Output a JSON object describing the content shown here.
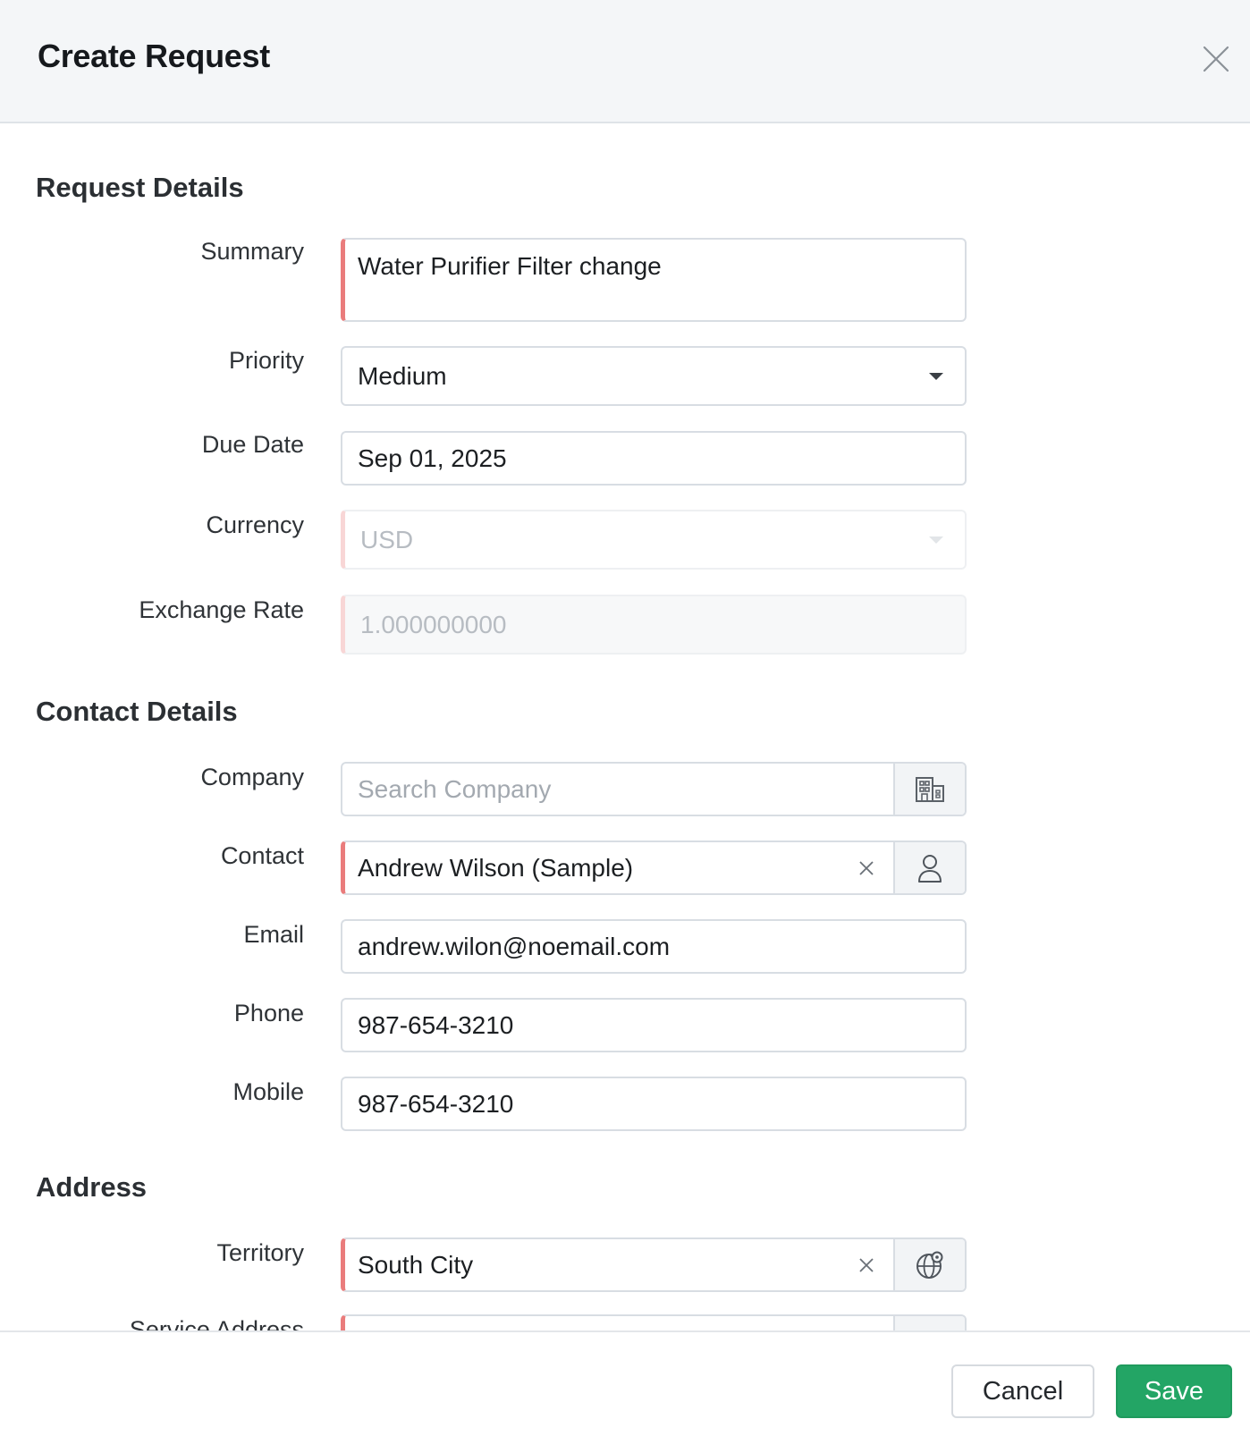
{
  "dialog": {
    "title": "Create Request"
  },
  "sections": {
    "request_details": "Request Details",
    "contact_details": "Contact Details",
    "address": "Address"
  },
  "fields": {
    "summary": {
      "label": "Summary",
      "value": "Water Purifier Filter change"
    },
    "priority": {
      "label": "Priority",
      "value": "Medium"
    },
    "due_date": {
      "label": "Due Date",
      "value": "Sep 01, 2025"
    },
    "currency": {
      "label": "Currency",
      "value": "USD"
    },
    "exchange_rate": {
      "label": "Exchange Rate",
      "value": "1.000000000"
    },
    "company": {
      "label": "Company",
      "placeholder": "Search Company"
    },
    "contact": {
      "label": "Contact",
      "value": "Andrew Wilson (Sample)"
    },
    "email": {
      "label": "Email",
      "value": "andrew.wilon@noemail.com"
    },
    "phone": {
      "label": "Phone",
      "value": "987-654-3210"
    },
    "mobile": {
      "label": "Mobile",
      "value": "987-654-3210"
    },
    "territory": {
      "label": "Territory",
      "value": "South City"
    },
    "service_address": {
      "label": "Service Address"
    }
  },
  "footer": {
    "cancel_label": "Cancel",
    "save_label": "Save"
  },
  "colors": {
    "required_marker": "#ea7c7c",
    "primary": "#23a565"
  }
}
